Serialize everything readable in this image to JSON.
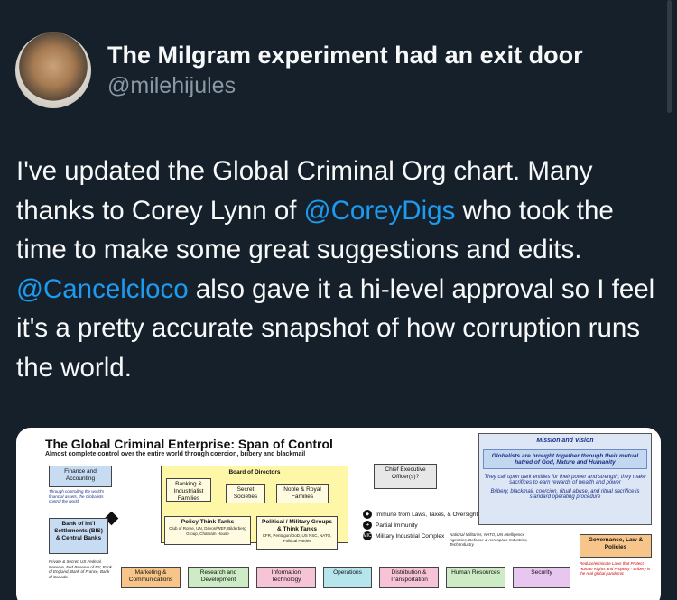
{
  "author": {
    "display_name": "The Milgram experiment had an exit door",
    "handle": "@milehijules",
    "avatar_icon": "avatar-photo"
  },
  "tweet": {
    "part1": "I've updated the Global Criminal Org chart. Many thanks to Corey Lynn of ",
    "mention1": "@CoreyDigs",
    "part2": " who took the time to make some great suggestions and edits. ",
    "mention2": "@Cancelcloco",
    "part3": " also gave it a hi-level approval so I feel it's a pretty accurate snapshot of how corruption runs the world."
  },
  "colors": {
    "background": "#15202b",
    "text": "#f7f9f9",
    "secondary": "#8b98a5",
    "link": "#1d9bf0"
  },
  "media": {
    "title": "The Global Criminal Enterprise: Span of Control",
    "subtitle": "Almost complete control over the entire world through coercion, bribery and blackmail",
    "finance": "Finance and Accounting",
    "finance_note": "Through controlling the world's financial assets, the Globalists control the world",
    "bis": "Bank of Int'l Settlements (BIS) & Central Banks",
    "banks_list": "Private & Secret: US Federal Reserve, Fed Reserve of NY, Bank of England, Bank of France, Bank of Canada",
    "board": "Board of Directors",
    "banking": "Banking & Industrialist Families",
    "secret": "Secret Societies",
    "noble": "Noble & Royal Families",
    "policy": "Policy Think Tanks",
    "policy_note": "Club of Rome, UN, Davos/WEF, Bilderberg Group, Chatham House",
    "political": "Political / Military Groups & Think Tanks",
    "political_note": "CFR, Pentagon/DoD, US NSC, NATO, Political Parties",
    "ceo": "Chief Executive Officer(s)?",
    "legend_immune": "Immune from Laws, Taxes, & Oversight",
    "legend_partial": "Partial Immunity",
    "legend_mic": "Military Industrial Complex",
    "mic_label": "MIC",
    "mic_note": "National Militaries, NATO, UN Intelligence Agencies, Defense & Aerospace Industries, Tech Industry",
    "mission_title": "Mission and Vision",
    "mission_main": "Globalists are brought together through their mutual hatred of God, Nature and Humanity",
    "mission_2": "They call upon dark entities for their power and strength; they make sacrifices to earn rewards of wealth and power",
    "mission_3": "Bribery, blackmail, coercion, ritual abuse, and ritual sacrifice is standard operating procedure",
    "governance": "Governance, Law & Policies",
    "governance_note": "Reduce/eliminate Laws that Protect Human Rights and Property - Bribery is the real global pandemic",
    "departments": [
      "Marketing & Communications",
      "Research and Development",
      "Information Technology",
      "Operations",
      "Distribution & Transportation",
      "Human Resources",
      "Security"
    ]
  }
}
